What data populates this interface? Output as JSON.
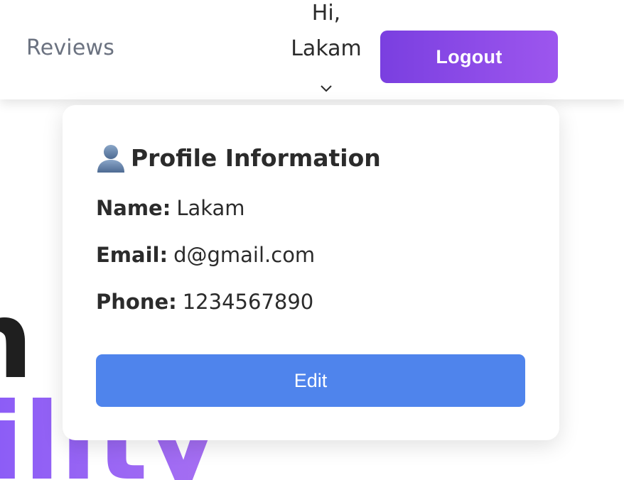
{
  "nav": {
    "reviews_label": "Reviews",
    "greeting_line1": "Hi,",
    "greeting_line2": "Lakam",
    "logout_label": "Logout"
  },
  "hero": {
    "dark_text": "n",
    "purple_text": "ility"
  },
  "profile": {
    "title": "Profile Information",
    "name_label": "Name:",
    "name_value": "Lakam",
    "email_label": "Email:",
    "email_value": "d@gmail.com",
    "phone_label": "Phone:",
    "phone_value": "1234567890",
    "edit_label": "Edit"
  },
  "colors": {
    "logout_gradient_start": "#7a3fe0",
    "logout_gradient_end": "#9d56ee",
    "edit_button": "#4f84ec",
    "nav_link": "#6b7280",
    "text_dark": "#2b2b2b",
    "hero_purple": "#9a63f0"
  },
  "icons": {
    "profile_title_icon": "person-silhouette-icon",
    "greeting_dropdown_icon": "chevron-down-icon"
  }
}
